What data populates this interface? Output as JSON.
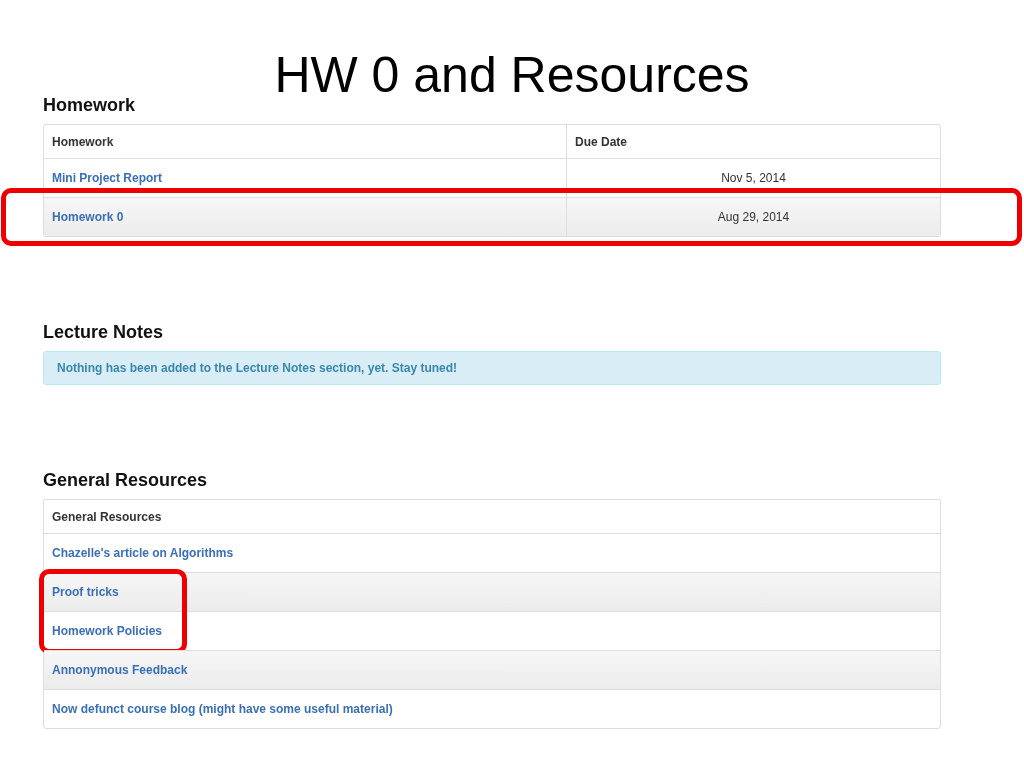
{
  "slide_title": "HW 0 and Resources",
  "homework": {
    "heading": "Homework",
    "columns": [
      "Homework",
      "Due Date"
    ],
    "rows": [
      {
        "title": "Mini Project Report",
        "due": "Nov 5, 2014",
        "highlighted": false
      },
      {
        "title": "Homework 0",
        "due": "Aug 29, 2014",
        "highlighted": true
      }
    ]
  },
  "lecture_notes": {
    "heading": "Lecture Notes",
    "notice": "Nothing has been added to the Lecture Notes section, yet. Stay tuned!"
  },
  "general_resources": {
    "heading": "General Resources",
    "column": "General Resources",
    "rows": [
      {
        "title": "Chazelle's article on Algorithms",
        "highlighted": false
      },
      {
        "title": "Proof tricks",
        "highlighted": true
      },
      {
        "title": "Homework Policies",
        "highlighted": true
      },
      {
        "title": "Annonymous Feedback",
        "highlighted": false
      },
      {
        "title": "Now defunct course blog (might have some useful material)",
        "highlighted": false
      }
    ]
  }
}
